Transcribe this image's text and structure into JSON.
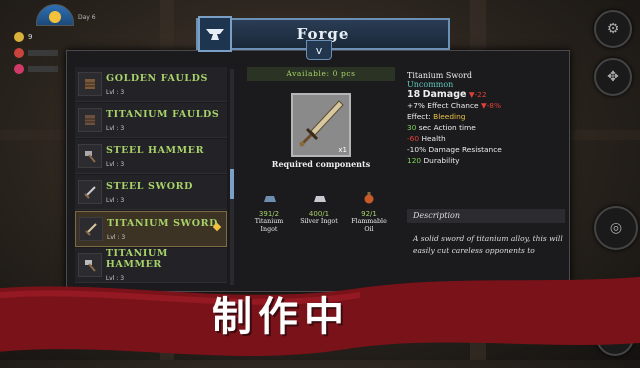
{
  "hud": {
    "day_label": "Day 6",
    "stats": [
      {
        "icon": "coin-icon",
        "color": "#d8b23a",
        "value": "9"
      },
      {
        "icon": "hunger-icon",
        "color": "#c8443c",
        "value": ""
      },
      {
        "icon": "health-icon",
        "color": "#d03a6a",
        "value": ""
      }
    ]
  },
  "header": {
    "title": "Forge",
    "collapse_label": "v"
  },
  "recipes": [
    {
      "name": "Golden Faulds",
      "level": "Lvl : 3",
      "icon": "faulds-icon",
      "selected": false
    },
    {
      "name": "Titanium Faulds",
      "level": "Lvl : 3",
      "icon": "faulds-icon",
      "selected": false
    },
    {
      "name": "Steel Hammer",
      "level": "Lvl : 3",
      "icon": "hammer-icon",
      "selected": false
    },
    {
      "name": "Steel Sword",
      "level": "Lvl : 3",
      "icon": "sword-icon",
      "selected": false
    },
    {
      "name": "Titanium Sword",
      "level": "Lvl : 3",
      "icon": "sword-icon",
      "selected": true
    },
    {
      "name": "Titanium Hammer",
      "level": "Lvl : 3",
      "icon": "hammer-icon",
      "selected": false
    }
  ],
  "center": {
    "available": "Available: 0 pcs",
    "result_qty": "x1",
    "required_label": "Required components",
    "components": [
      {
        "count": "391/2",
        "name1": "Titanium",
        "name2": "Ingot",
        "icon": "titanium-ingot-icon"
      },
      {
        "count": "400/1",
        "name1": "Silver Ingot",
        "name2": "",
        "icon": "silver-ingot-icon"
      },
      {
        "count": "92/1",
        "name1": "Flammable",
        "name2": "Oil",
        "icon": "flammable-oil-icon"
      }
    ]
  },
  "details": {
    "name": "Titanium Sword",
    "rarity": "Uncommon",
    "damage_value": "18",
    "damage_label": "Damage",
    "damage_delta": "-22",
    "effect_chance_value": "+7%",
    "effect_chance_label": "Effect Chance",
    "effect_chance_delta": "-8%",
    "effect_label": "Effect:",
    "effect_value": "Bleeding",
    "action_time_value": "30",
    "action_time_label": "sec Action time",
    "health_value": "-60",
    "health_label": "Health",
    "resistance_value": "-10%",
    "resistance_label": "Damage Resistance",
    "durability_value": "120",
    "durability_label": "Durability",
    "description_header": "Description",
    "description": "A solid sword of titanium alloy, this will easily cut careless opponents to"
  },
  "banner": {
    "text": "制作中"
  }
}
